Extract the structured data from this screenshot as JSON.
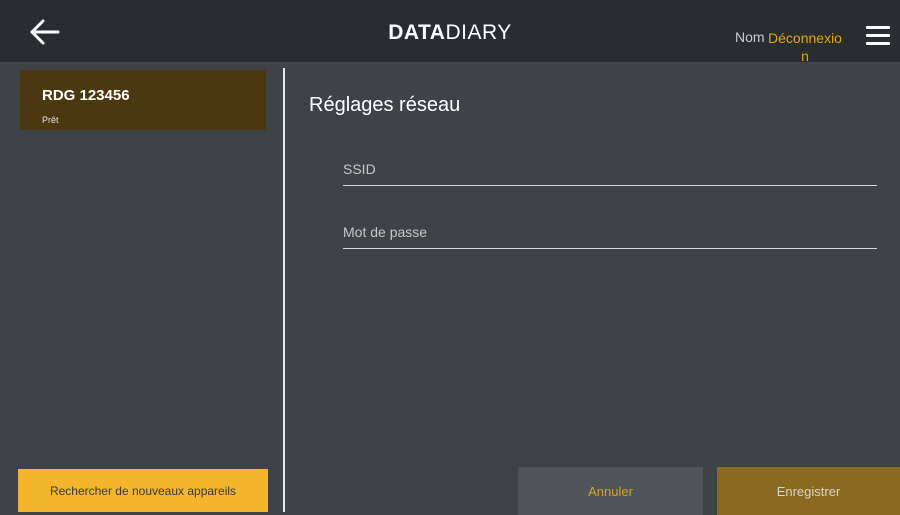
{
  "header": {
    "logo_bold": "DATA",
    "logo_light": "DIARY",
    "user_name": "Nom",
    "logout_label": "Déconnexion",
    "back_icon": "arrow-left-icon",
    "menu_icon": "hamburger-menu-icon"
  },
  "sidebar": {
    "devices": [
      {
        "name": "RDG 123456",
        "status": "Prêt"
      }
    ],
    "scan_button_label": "Rechercher de nouveaux appareils"
  },
  "main": {
    "title": "Réglages réseau",
    "ssid": {
      "placeholder": "SSID",
      "value": ""
    },
    "password": {
      "placeholder": "Mot de passe",
      "value": ""
    },
    "cancel_label": "Annuler",
    "save_label": "Enregistrer"
  },
  "colors": {
    "accent": "#f2b52c",
    "accent_text": "#e2a512",
    "topbar": "#282d2f",
    "background": "#3d4346",
    "selected_device": "#4b3710",
    "save_button": "#8a6a20"
  }
}
